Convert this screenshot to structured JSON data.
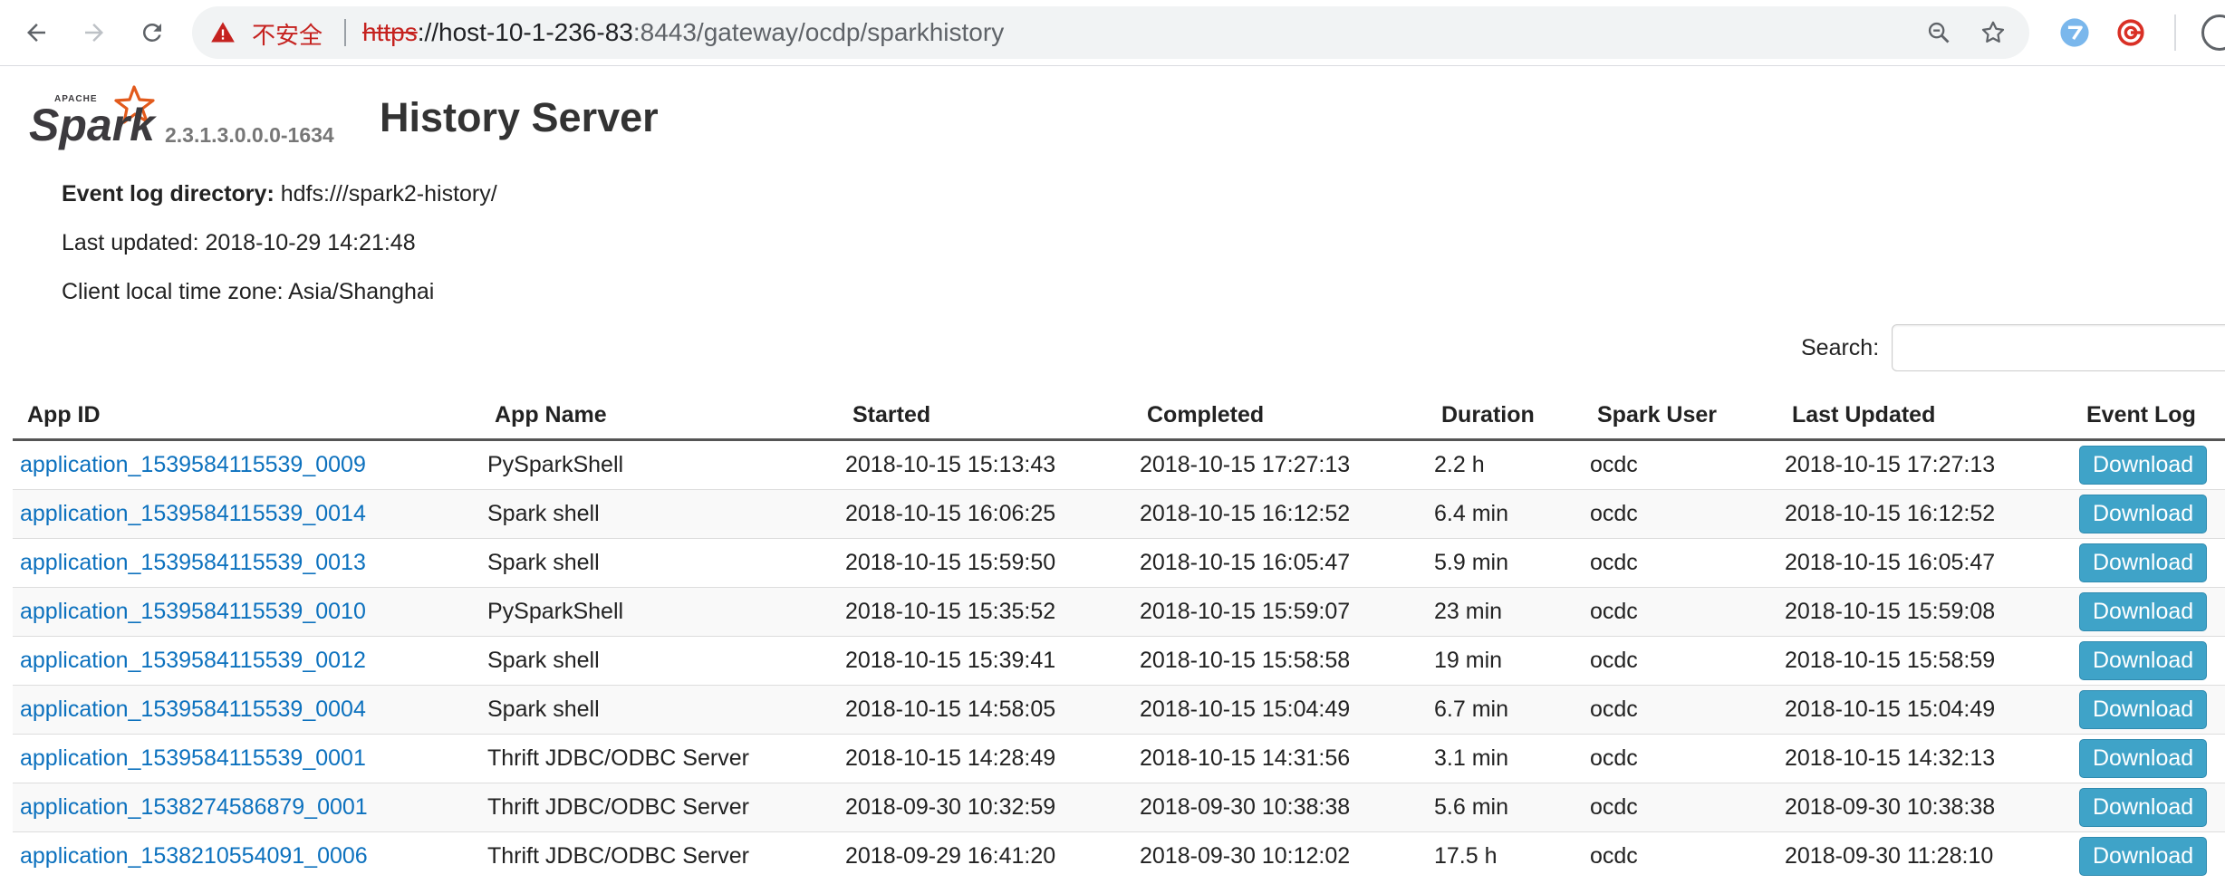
{
  "browser": {
    "security_text": "不安全",
    "url_scheme": "https",
    "url_host": "://host-10-1-236-83",
    "url_port": ":8443",
    "url_path": "/gateway/ocdp/sparkhistory",
    "icons": [
      "back-icon",
      "forward-icon",
      "reload-icon",
      "warning-icon",
      "zoom-icon",
      "star-icon",
      "extension-icon",
      "target-icon"
    ]
  },
  "header": {
    "logo_text": "Spark",
    "logo_super": "APACHE",
    "version": "2.3.1.3.0.0.0-1634",
    "title": "History Server"
  },
  "info": {
    "event_log_label": "Event log directory:",
    "event_log_value": "hdfs:///spark2-history/",
    "last_updated": "Last updated: 2018-10-29 14:21:48",
    "timezone": "Client local time zone: Asia/Shanghai"
  },
  "search": {
    "label": "Search:",
    "value": ""
  },
  "table": {
    "columns": [
      "App ID",
      "App Name",
      "Started",
      "Completed",
      "Duration",
      "Spark User",
      "Last Updated",
      "Event Log"
    ],
    "download_label": "Download",
    "rows": [
      [
        "application_1539584115539_0009",
        "PySparkShell",
        "2018-10-15 15:13:43",
        "2018-10-15 17:27:13",
        "2.2 h",
        "ocdc",
        "2018-10-15 17:27:13"
      ],
      [
        "application_1539584115539_0014",
        "Spark shell",
        "2018-10-15 16:06:25",
        "2018-10-15 16:12:52",
        "6.4 min",
        "ocdc",
        "2018-10-15 16:12:52"
      ],
      [
        "application_1539584115539_0013",
        "Spark shell",
        "2018-10-15 15:59:50",
        "2018-10-15 16:05:47",
        "5.9 min",
        "ocdc",
        "2018-10-15 16:05:47"
      ],
      [
        "application_1539584115539_0010",
        "PySparkShell",
        "2018-10-15 15:35:52",
        "2018-10-15 15:59:07",
        "23 min",
        "ocdc",
        "2018-10-15 15:59:08"
      ],
      [
        "application_1539584115539_0012",
        "Spark shell",
        "2018-10-15 15:39:41",
        "2018-10-15 15:58:58",
        "19 min",
        "ocdc",
        "2018-10-15 15:58:59"
      ],
      [
        "application_1539584115539_0004",
        "Spark shell",
        "2018-10-15 14:58:05",
        "2018-10-15 15:04:49",
        "6.7 min",
        "ocdc",
        "2018-10-15 15:04:49"
      ],
      [
        "application_1539584115539_0001",
        "Thrift JDBC/ODBC Server",
        "2018-10-15 14:28:49",
        "2018-10-15 14:31:56",
        "3.1 min",
        "ocdc",
        "2018-10-15 14:32:13"
      ],
      [
        "application_1538274586879_0001",
        "Thrift JDBC/ODBC Server",
        "2018-09-30 10:32:59",
        "2018-09-30 10:38:38",
        "5.6 min",
        "ocdc",
        "2018-09-30 10:38:38"
      ],
      [
        "application_1538210554091_0006",
        "Thrift JDBC/ODBC Server",
        "2018-09-29 16:41:20",
        "2018-09-30 10:12:02",
        "17.5 h",
        "ocdc",
        "2018-09-30 11:28:10"
      ]
    ]
  }
}
